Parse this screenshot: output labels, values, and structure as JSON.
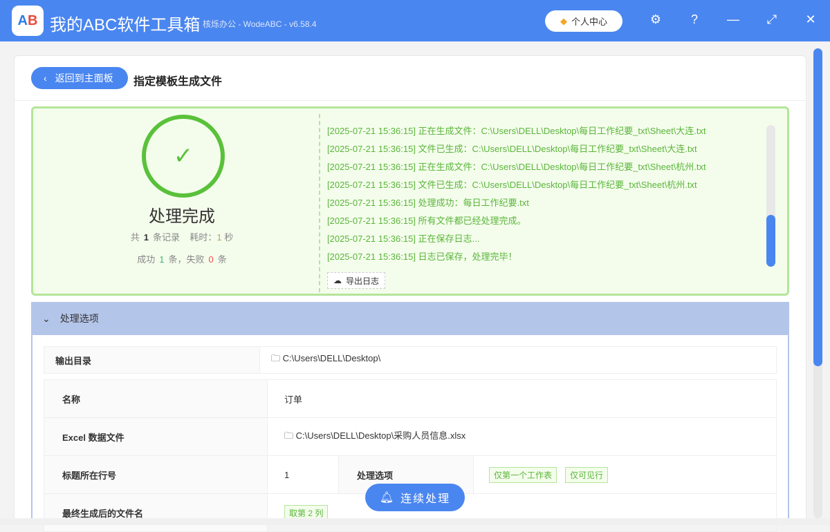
{
  "app": {
    "title": "我的ABC软件工具箱",
    "subtitle": "核烁办公 - WodeABC - v6.58.4",
    "logo": "AB",
    "user_center": "个人中心"
  },
  "header": {
    "back": "返回到主面板",
    "title": "指定模板生成文件"
  },
  "result": {
    "status": "处理完成",
    "total_prefix": "共",
    "total": "1",
    "total_suffix": "条记录",
    "time_label": "耗时：",
    "time": "1",
    "time_unit": "秒",
    "success_label": "成功",
    "success": "1",
    "mid": "条，失败",
    "fail": "0",
    "fail_suffix": "条",
    "logs": [
      "[2025-07-21 15:36:15] 正在生成文件：C:\\Users\\DELL\\Desktop\\每日工作纪要_txt\\Sheet\\大连.txt",
      "[2025-07-21 15:36:15] 文件已生成：C:\\Users\\DELL\\Desktop\\每日工作纪要_txt\\Sheet\\大连.txt",
      "[2025-07-21 15:36:15] 正在生成文件：C:\\Users\\DELL\\Desktop\\每日工作纪要_txt\\Sheet\\杭州.txt",
      "[2025-07-21 15:36:15] 文件已生成：C:\\Users\\DELL\\Desktop\\每日工作纪要_txt\\Sheet\\杭州.txt",
      "[2025-07-21 15:36:15] 处理成功：每日工作纪要.txt",
      "[2025-07-21 15:36:15] 所有文件都已经处理完成。",
      "[2025-07-21 15:36:15] 正在保存日志...",
      "[2025-07-21 15:36:15] 日志已保存，处理完毕！"
    ],
    "export": "导出日志",
    "log_scroll_fraction": 1.0
  },
  "options": {
    "title": "处理选项",
    "output_dir_label": "输出目录",
    "output_dir": "C:\\Users\\DELL\\Desktop\\",
    "name_label": "名称",
    "name": "订单",
    "excel_label": "Excel 数据文件",
    "excel": "C:\\Users\\DELL\\Desktop\\采购人员信息.xlsx",
    "header_row_label": "标题所在行号",
    "header_row": "1",
    "proc_label": "处理选项",
    "proc_tags": [
      "仅第一个工作表",
      "仅可见行"
    ],
    "filename_label": "最终生成后的文件名",
    "filename_tag": "取第 2 列"
  },
  "continue": "连续处理"
}
